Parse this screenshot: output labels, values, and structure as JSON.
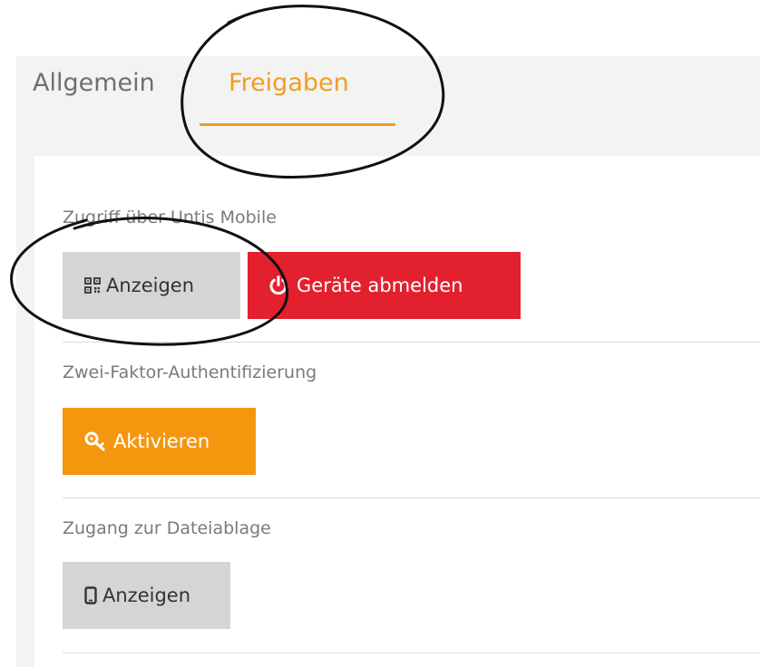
{
  "tabs": {
    "items": [
      {
        "label": "Allgemein"
      },
      {
        "label": "Freigaben"
      }
    ],
    "active_color": "#f39c1f"
  },
  "sections": [
    {
      "title": "Zugriff über Untis Mobile",
      "buttons": [
        {
          "label": "Anzeigen",
          "icon": "qr-code-icon"
        },
        {
          "label": "Geräte abmelden",
          "icon": "power-icon"
        }
      ]
    },
    {
      "title": "Zwei-Faktor-Authentifizierung",
      "buttons": [
        {
          "label": "Aktivieren",
          "icon": "key-icon"
        }
      ]
    },
    {
      "title": "Zugang zur Dateiablage",
      "buttons": [
        {
          "label": "Anzeigen",
          "icon": "mobile-phone-icon"
        }
      ]
    }
  ],
  "colors": {
    "accent": "#f39c1f",
    "danger": "#e3202e",
    "warning": "#f5960f",
    "neutral_button": "#d5d5d5"
  }
}
